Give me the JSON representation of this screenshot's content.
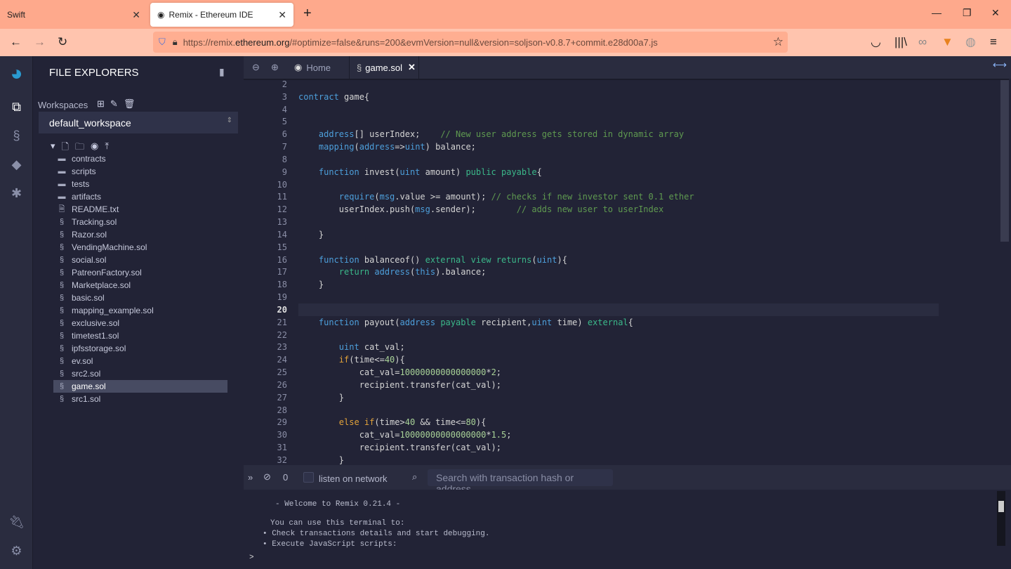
{
  "browser": {
    "tabs": [
      {
        "title": "Swift",
        "active": false
      },
      {
        "title": "Remix - Ethereum IDE",
        "active": true
      }
    ],
    "url_prefix": "https://remix.",
    "url_domain": "ethereum.org",
    "url_rest": "/#optimize=false&runs=200&evmVersion=null&version=soljson-v0.8.7+commit.e28d00a7.js"
  },
  "sidepanel": {
    "title": "FILE EXPLORERS",
    "workspaces_label": "Workspaces",
    "workspace": "default_workspace",
    "files": [
      {
        "name": "contracts",
        "type": "folder"
      },
      {
        "name": "scripts",
        "type": "folder"
      },
      {
        "name": "tests",
        "type": "folder"
      },
      {
        "name": "artifacts",
        "type": "folder"
      },
      {
        "name": "README.txt",
        "type": "text"
      },
      {
        "name": "Tracking.sol",
        "type": "sol"
      },
      {
        "name": "Razor.sol",
        "type": "sol"
      },
      {
        "name": "VendingMachine.sol",
        "type": "sol"
      },
      {
        "name": "social.sol",
        "type": "sol"
      },
      {
        "name": "PatreonFactory.sol",
        "type": "sol"
      },
      {
        "name": "Marketplace.sol",
        "type": "sol"
      },
      {
        "name": "basic.sol",
        "type": "sol"
      },
      {
        "name": "mapping_example.sol",
        "type": "sol"
      },
      {
        "name": "exclusive.sol",
        "type": "sol"
      },
      {
        "name": "timetest1.sol",
        "type": "sol"
      },
      {
        "name": "ipfsstorage.sol",
        "type": "sol"
      },
      {
        "name": "ev.sol",
        "type": "sol"
      },
      {
        "name": "src2.sol",
        "type": "sol"
      },
      {
        "name": "game.sol",
        "type": "sol",
        "selected": true
      },
      {
        "name": "src1.sol",
        "type": "sol"
      }
    ]
  },
  "editor": {
    "tabs": [
      {
        "label": "Home"
      },
      {
        "label": "game.sol",
        "active": true
      }
    ],
    "current_line": 20,
    "lines": [
      {
        "n": 2,
        "t": []
      },
      {
        "n": 3,
        "t": [
          [
            "k",
            "contract"
          ],
          [
            "t",
            " game{"
          ]
        ]
      },
      {
        "n": 4,
        "t": []
      },
      {
        "n": 5,
        "t": []
      },
      {
        "n": 6,
        "t": [
          [
            "k",
            "    address"
          ],
          [
            "t",
            "[] userIndex;    "
          ],
          [
            "c",
            "// New user address gets stored in dynamic array"
          ]
        ]
      },
      {
        "n": 7,
        "t": [
          [
            "k",
            "    mapping"
          ],
          [
            "t",
            "("
          ],
          [
            "k",
            "address"
          ],
          [
            "t",
            "=>"
          ],
          [
            "k",
            "uint"
          ],
          [
            "t",
            ") balance;"
          ]
        ]
      },
      {
        "n": 8,
        "t": []
      },
      {
        "n": 9,
        "t": [
          [
            "k",
            "    function"
          ],
          [
            "t",
            " invest("
          ],
          [
            "k",
            "uint"
          ],
          [
            "t",
            " amount) "
          ],
          [
            "g",
            "public payable"
          ],
          [
            "t",
            "{"
          ]
        ]
      },
      {
        "n": 10,
        "t": []
      },
      {
        "n": 11,
        "t": [
          [
            "k",
            "        require"
          ],
          [
            "t",
            "("
          ],
          [
            "k",
            "msg"
          ],
          [
            "t",
            ".value >= amount); "
          ],
          [
            "c",
            "// checks if new investor sent 0.1 ether"
          ]
        ]
      },
      {
        "n": 12,
        "t": [
          [
            "t",
            "        userIndex.push("
          ],
          [
            "k",
            "msg"
          ],
          [
            "t",
            ".sender);        "
          ],
          [
            "c",
            "// adds new user to userIndex"
          ]
        ]
      },
      {
        "n": 13,
        "t": []
      },
      {
        "n": 14,
        "t": [
          [
            "t",
            "    }"
          ]
        ]
      },
      {
        "n": 15,
        "t": []
      },
      {
        "n": 16,
        "t": [
          [
            "k",
            "    function"
          ],
          [
            "t",
            " balanceof() "
          ],
          [
            "g",
            "external view returns"
          ],
          [
            "t",
            "("
          ],
          [
            "k",
            "uint"
          ],
          [
            "t",
            "){"
          ]
        ]
      },
      {
        "n": 17,
        "t": [
          [
            "g",
            "        return"
          ],
          [
            "t",
            " "
          ],
          [
            "k",
            "address"
          ],
          [
            "t",
            "("
          ],
          [
            "k",
            "this"
          ],
          [
            "t",
            ").balance;"
          ]
        ]
      },
      {
        "n": 18,
        "t": [
          [
            "t",
            "    }"
          ]
        ]
      },
      {
        "n": 19,
        "t": []
      },
      {
        "n": 20,
        "t": []
      },
      {
        "n": 21,
        "t": [
          [
            "k",
            "    function"
          ],
          [
            "t",
            " payout("
          ],
          [
            "k",
            "address"
          ],
          [
            "t",
            " "
          ],
          [
            "g",
            "payable"
          ],
          [
            "t",
            " recipient,"
          ],
          [
            "k",
            "uint"
          ],
          [
            "t",
            " time) "
          ],
          [
            "g",
            "external"
          ],
          [
            "t",
            "{"
          ]
        ]
      },
      {
        "n": 22,
        "t": []
      },
      {
        "n": 23,
        "t": [
          [
            "k",
            "        uint"
          ],
          [
            "t",
            " cat_val;"
          ]
        ]
      },
      {
        "n": 24,
        "t": [
          [
            "o",
            "        if"
          ],
          [
            "t",
            "(time<="
          ],
          [
            "n",
            "40"
          ],
          [
            "t",
            "){"
          ]
        ]
      },
      {
        "n": 25,
        "t": [
          [
            "t",
            "            cat_val="
          ],
          [
            "n",
            "10000000000000000"
          ],
          [
            "t",
            "*"
          ],
          [
            "n",
            "2"
          ],
          [
            "t",
            ";"
          ]
        ]
      },
      {
        "n": 26,
        "t": [
          [
            "t",
            "            recipient.transfer(cat_val);"
          ]
        ]
      },
      {
        "n": 27,
        "t": [
          [
            "t",
            "        }"
          ]
        ]
      },
      {
        "n": 28,
        "t": []
      },
      {
        "n": 29,
        "t": [
          [
            "o",
            "        else if"
          ],
          [
            "t",
            "(time>"
          ],
          [
            "n",
            "40"
          ],
          [
            "t",
            " && time<="
          ],
          [
            "n",
            "80"
          ],
          [
            "t",
            "){"
          ]
        ]
      },
      {
        "n": 30,
        "t": [
          [
            "t",
            "            cat_val="
          ],
          [
            "n",
            "10000000000000000"
          ],
          [
            "t",
            "*"
          ],
          [
            "n",
            "1.5"
          ],
          [
            "t",
            ";"
          ]
        ]
      },
      {
        "n": 31,
        "t": [
          [
            "t",
            "            recipient.transfer(cat_val);"
          ]
        ]
      },
      {
        "n": 32,
        "t": [
          [
            "t",
            "        }"
          ]
        ]
      }
    ]
  },
  "terminal": {
    "count": "0",
    "listen_label": "listen on network",
    "search_placeholder": "Search with transaction hash or address",
    "welcome": "- Welcome to Remix 0.21.4 -",
    "intro": "You can use this terminal to:",
    "bullets": [
      "Check transactions details and start debugging.",
      "Execute JavaScript scripts:"
    ],
    "prompt": ">"
  }
}
